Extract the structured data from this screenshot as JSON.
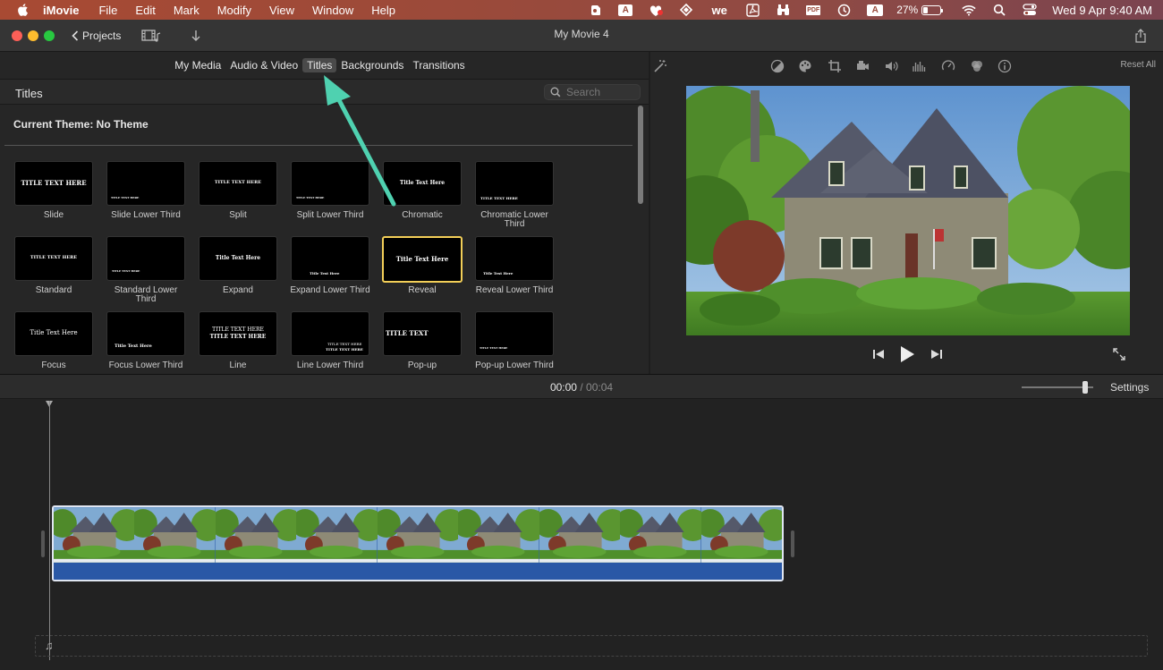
{
  "menubar": {
    "app_name": "iMovie",
    "items": [
      "File",
      "Edit",
      "Mark",
      "Modify",
      "View",
      "Window",
      "Help"
    ],
    "status_icons": [
      "evernote-icon",
      "text-a-icon",
      "app-badge-icon",
      "grid-icon",
      "we-icon",
      "acrobat-icon",
      "binoculars-icon",
      "pdf-icon",
      "clock-icon",
      "input-a-icon",
      "battery-icon",
      "wifi-icon",
      "search-icon",
      "control-center-icon"
    ],
    "pdf_label": "PDF",
    "we_label": "we",
    "a_label": "A",
    "battery_text": "27%",
    "battery_level": 0.27,
    "clock": "Wed 9 Apr  9:40 AM"
  },
  "window": {
    "title": "My Movie 4",
    "projects_label": "Projects"
  },
  "browser": {
    "tabs": [
      {
        "label": "My Media",
        "active": false
      },
      {
        "label": "Audio & Video",
        "active": false
      },
      {
        "label": "Titles",
        "active": true
      },
      {
        "label": "Backgrounds",
        "active": false
      },
      {
        "label": "Transitions",
        "active": false
      }
    ],
    "section_title": "Titles",
    "search_placeholder": "Search",
    "theme_label": "Current Theme: No Theme",
    "titles": [
      {
        "label": "Slide",
        "thumb_text": "TITLE TEXT HERE"
      },
      {
        "label": "Slide Lower Third",
        "thumb_text": "TITLE TEXT HERE"
      },
      {
        "label": "Split",
        "thumb_text": "TITLE TEXT HERE"
      },
      {
        "label": "Split Lower Third",
        "thumb_text": "TITLE TEXT HERE"
      },
      {
        "label": "Chromatic",
        "thumb_text": "Title Text Here"
      },
      {
        "label": "Chromatic Lower Third",
        "thumb_text": "TITLE TEXT HERE"
      },
      {
        "label": "Standard",
        "thumb_text": "TITLE TEXT HERE"
      },
      {
        "label": "Standard Lower Third",
        "thumb_text": "TITLE TEXT HERE"
      },
      {
        "label": "Expand",
        "thumb_text": "Title Text Here"
      },
      {
        "label": "Expand Lower Third",
        "thumb_text": "Title Text Here"
      },
      {
        "label": "Reveal",
        "thumb_text": "Title Text Here",
        "selected": true
      },
      {
        "label": "Reveal Lower Third",
        "thumb_text": "Title Text Here"
      },
      {
        "label": "Focus",
        "thumb_text": "Title Text Here"
      },
      {
        "label": "Focus Lower Third",
        "thumb_text": "Title Text Here"
      },
      {
        "label": "Line",
        "thumb_text": "TITLE TEXT HERE"
      },
      {
        "label": "Line Lower Third",
        "thumb_text": "TITLE TEXT HERE"
      },
      {
        "label": "Pop-up",
        "thumb_text": "TITLE TEXT"
      },
      {
        "label": "Pop-up Lower Third",
        "thumb_text": "TITLE TEXT HERE"
      }
    ]
  },
  "viewer": {
    "reset_label": "Reset All",
    "adjust_icons": [
      "magic-wand-icon",
      "color-balance-icon",
      "color-palette-icon",
      "crop-icon",
      "stabilization-icon",
      "volume-icon",
      "equalizer-icon",
      "speed-icon",
      "filter-icon",
      "info-icon"
    ]
  },
  "timeline": {
    "current_time": "00:00",
    "separator": "/",
    "duration": "00:04",
    "settings_label": "Settings",
    "zoom_level": 0.92
  },
  "colors": {
    "accent_arrow": "#4fd1b0",
    "selection": "#f3cf58",
    "clip_blue": "#2d5ca8"
  }
}
